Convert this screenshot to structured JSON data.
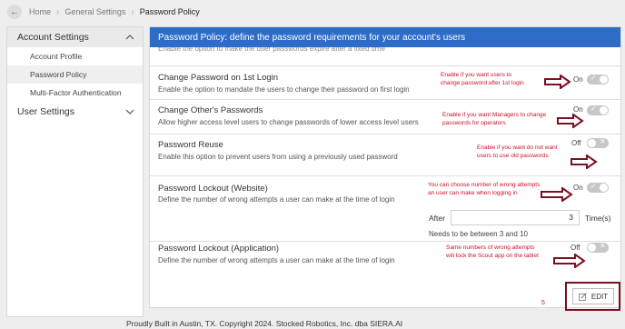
{
  "breadcrumb": {
    "back_icon": "arrow-left-icon",
    "items": [
      "Home",
      "General Settings",
      "Password Policy"
    ]
  },
  "sidebar": {
    "sections": [
      {
        "label": "Account Settings",
        "expanded": true,
        "items": [
          "Account Profile",
          "Password Policy",
          "Multi-Factor Authentication"
        ],
        "active": "Password Policy"
      },
      {
        "label": "User Settings",
        "expanded": false
      }
    ]
  },
  "panel": {
    "title": "Password Policy: define the password requirements for your account's users",
    "cut_text": "Enable the option to make the user passwords expire after a fixed time",
    "settings": [
      {
        "title": "Change Password on 1st Login",
        "desc": "Enable the option to mandate the users to change their password on first login",
        "state_label": "On",
        "enabled": true,
        "note": [
          "Enable if you want users to",
          "change password after 1st login"
        ]
      },
      {
        "title": "Change Other's Passwords",
        "desc": "Allow higher access level users to change passwords of lower access level users",
        "state_label": "On",
        "enabled": true,
        "note": [
          "Enable if you want Managers to change",
          "passwords for operators"
        ]
      },
      {
        "title": "Password Reuse",
        "desc": "Enable this option to prevent users from using a previously used password",
        "state_label": "Off",
        "enabled": false,
        "note": [
          "Enable if you want do not want",
          "users to use old passwords"
        ]
      },
      {
        "title": "Password Lockout (Website)",
        "desc": "Define the number of wrong attempts a user can make at the time of login",
        "state_label": "On",
        "enabled": true,
        "note": [
          "You can choose number of wrong attempts",
          "an user can make when logging in"
        ]
      },
      {
        "title": "Password Lockout (Application)",
        "desc": "Define the number of wrong attempts a user can make at the time of login",
        "state_label": "Off",
        "enabled": false,
        "note": [
          "Same numbers of wrong attempts",
          "will lock the Scout app on the tablet"
        ]
      }
    ],
    "lockout": {
      "prefix": "After",
      "value": "3",
      "suffix": "Time(s)",
      "hint": "Needs to be between 3 and 10"
    },
    "edit_button": {
      "label": "EDIT",
      "icon": "edit-icon"
    },
    "annotation_step": "5"
  },
  "footer": "Proudly Built in Austin, TX. Copyright 2024. Stocked Robotics, Inc. dba SIERA.AI",
  "colors": {
    "header": "#2d6dc7",
    "annotation": "#c8102e",
    "arrow": "#7a1020"
  }
}
